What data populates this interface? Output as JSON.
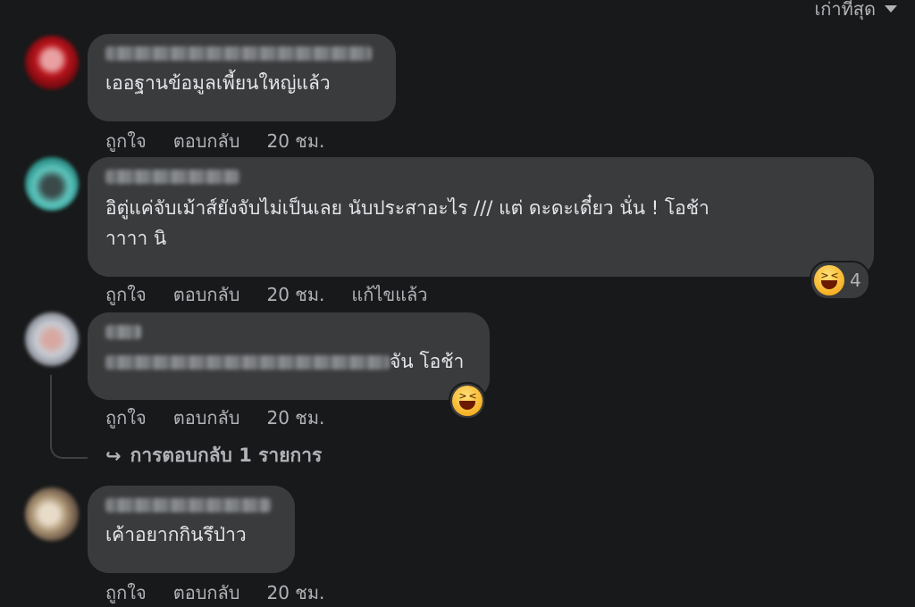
{
  "sort_label": "เก่าที่สุด",
  "comments": [
    {
      "text": "เออฐานข้อมูลเพี้ยนใหญ่แล้ว",
      "actions": {
        "like": "ถูกใจ",
        "reply": "ตอบกลับ",
        "time": "20 ชม."
      }
    },
    {
      "text_line1": "อิตู่แค่จับเม้าส์ยังจับไม่เป็นเลย นับประสาอะไร /// แต่ ดะดะเดี๋ยว นั่น ! โอช้า",
      "text_line2": "าาาา นิ",
      "reaction_count": "4",
      "reaction_icon": "laughing-emoji",
      "actions": {
        "like": "ถูกใจ",
        "reply": "ตอบกลับ",
        "time": "20 ชม.",
        "edited": "แก้ไขแล้ว"
      }
    },
    {
      "text_suffix": "จัน โอช้า",
      "reaction_icon": "laughing-emoji",
      "actions": {
        "like": "ถูกใจ",
        "reply": "ตอบกลับ",
        "time": "20 ชม."
      },
      "replies_label": "การตอบกลับ 1 รายการ"
    },
    {
      "text": "เค้าอยากกินรึป่าว",
      "actions": {
        "like": "ถูกใจ",
        "reply": "ตอบกลับ",
        "time": "20 ชม."
      }
    }
  ]
}
